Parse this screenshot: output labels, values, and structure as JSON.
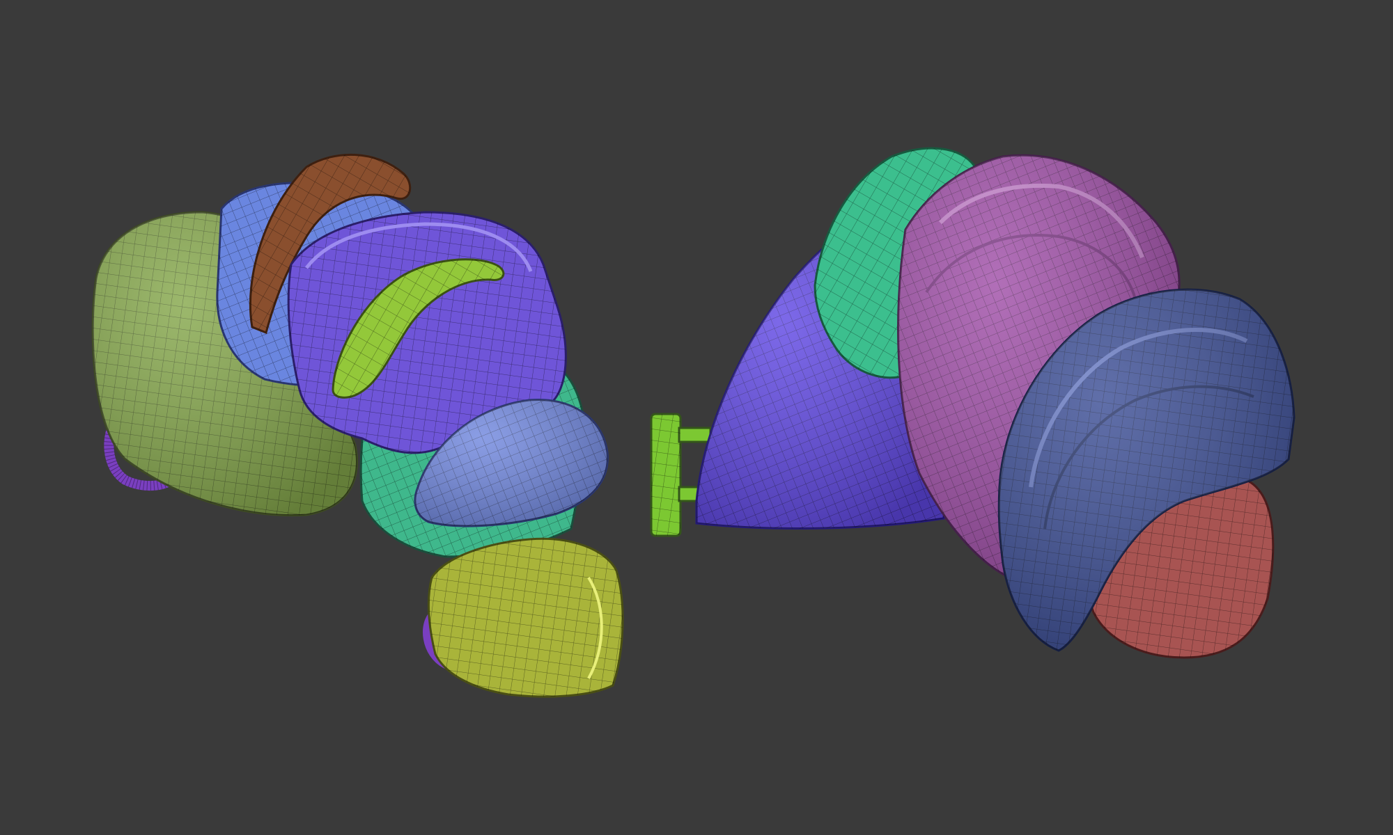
{
  "viewport": {
    "background": "#3a3a3a"
  },
  "models": [
    {
      "name": "left-shoulder-armor",
      "pieces": [
        {
          "name": "green-base-plate",
          "color": "#86a84c"
        },
        {
          "name": "blue-back-plate",
          "color": "#6a86e0"
        },
        {
          "name": "brown-fin",
          "color": "#8a4f2e"
        },
        {
          "name": "purple-main-plate",
          "color": "#6f55d8"
        },
        {
          "name": "lime-fin",
          "color": "#93c83a"
        },
        {
          "name": "teal-lower-plate",
          "color": "#3fb88c"
        },
        {
          "name": "blue-front-cap",
          "color": "#7188df"
        },
        {
          "name": "yellow-bottom-plate",
          "color": "#a9b43a"
        },
        {
          "name": "purple-loop-strap",
          "color": "#7a3fc0"
        }
      ]
    },
    {
      "name": "right-shoulder-armor",
      "pieces": [
        {
          "name": "violet-inner-plate",
          "color": "#6048e4"
        },
        {
          "name": "green-clip",
          "color": "#7cc832"
        },
        {
          "name": "teal-top-plate",
          "color": "#3cbf8e"
        },
        {
          "name": "magenta-main-plate",
          "color": "#a04fa8"
        },
        {
          "name": "navy-outer-plate",
          "color": "#3d4f96"
        },
        {
          "name": "red-under-plate",
          "color": "#a85452"
        }
      ]
    }
  ]
}
